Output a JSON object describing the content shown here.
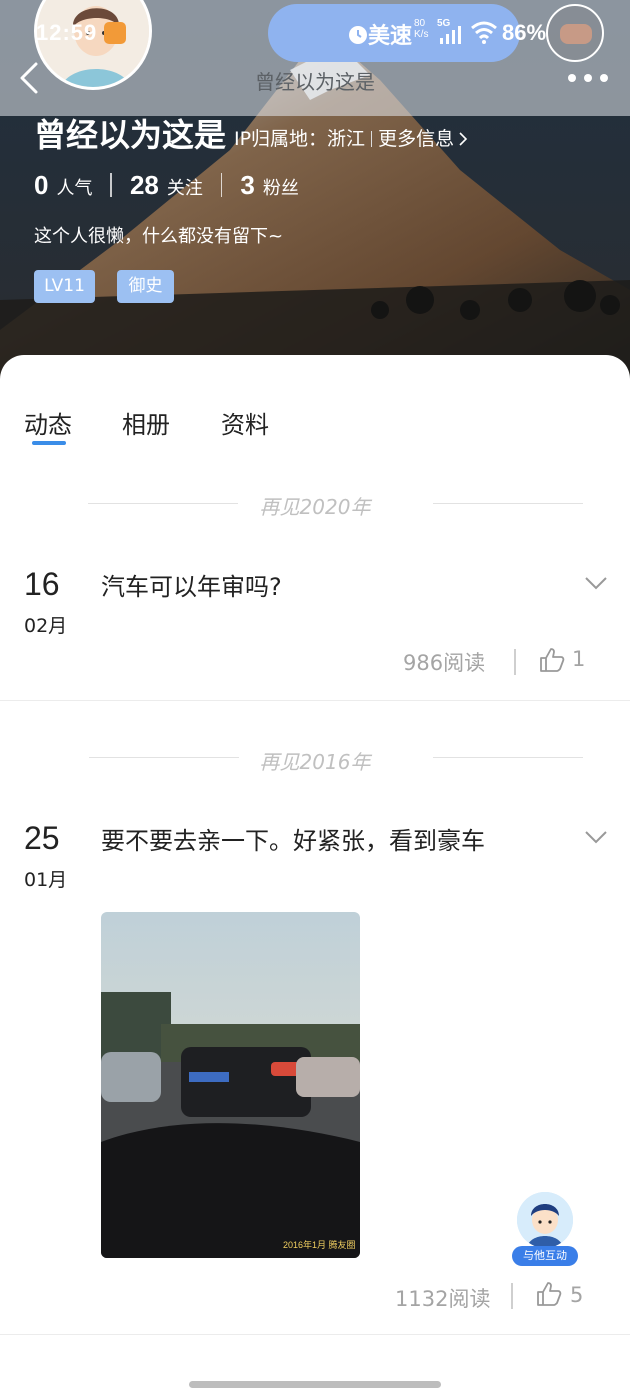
{
  "status_bar": {
    "time": "12:59",
    "speed": "美速",
    "net_speed_top": "80",
    "net_speed_unit": "K/s",
    "network": "5G",
    "battery": "86%"
  },
  "header": {
    "title": "曾经以为这是"
  },
  "profile": {
    "name": "曾经以为这是",
    "ip_location": "IP归属地：浙江",
    "more_info": "更多信息",
    "stats": [
      {
        "value": "0",
        "label": "人气"
      },
      {
        "value": "28",
        "label": "关注"
      },
      {
        "value": "3",
        "label": "粉丝"
      }
    ],
    "bio": "这个人很懒，什么都没有留下~",
    "level_tag": "LV11",
    "role_tag": "御史"
  },
  "tabs": [
    "动态",
    "相册",
    "资料"
  ],
  "feed": {
    "groups": [
      {
        "year_label": "再见2020年",
        "post": {
          "day": "16",
          "month": "02月",
          "text": "汽车可以年审吗?",
          "reads": "986阅读",
          "likes": "1"
        }
      },
      {
        "year_label": "再见2016年",
        "post": {
          "day": "25",
          "month": "01月",
          "text": "要不要去亲一下。好紧张，看到豪车",
          "reads": "1132阅读",
          "likes": "5",
          "photo_stamp": "2016年1月 腾友圈"
        }
      }
    ]
  },
  "interact_widget": {
    "label": "与他互动"
  },
  "colors": {
    "accent": "#3a8de8",
    "tag_bg": "#9cc0f2",
    "muted_text": "#a4a4a4"
  }
}
